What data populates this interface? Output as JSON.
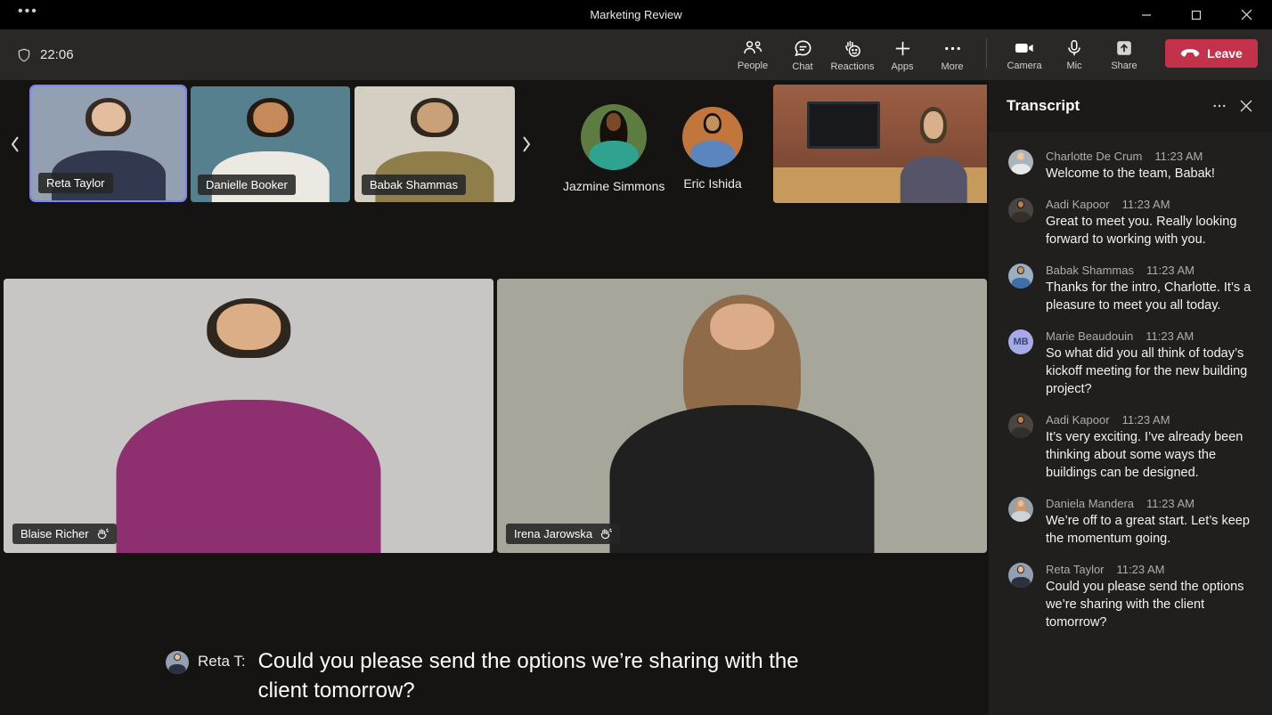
{
  "window": {
    "title": "Marketing Review",
    "controls": {
      "minimize": "minimize",
      "maximize": "maximize",
      "close": "close"
    }
  },
  "colors": {
    "titlebar_bg": "#000000",
    "toolbar_bg": "#292827",
    "main_bg": "#151413",
    "panel_bg": "#1b1a19",
    "panel_body_bg": "#201f1e",
    "leave_bg": "#c4314b",
    "speaking_border": "#7f85f5",
    "nameplate_bg": "rgba(38,38,38,0.88)",
    "text_primary": "#ffffff",
    "text_secondary": "#adadad"
  },
  "toolbar": {
    "timer": "22:06",
    "buttons": [
      {
        "label": "People"
      },
      {
        "label": "Chat"
      },
      {
        "label": "Reactions"
      },
      {
        "label": "Apps"
      },
      {
        "label": "More"
      }
    ],
    "device_buttons": [
      {
        "label": "Camera"
      },
      {
        "label": "Mic"
      },
      {
        "label": "Share"
      }
    ],
    "leave_label": "Leave"
  },
  "strip": {
    "tiles": [
      {
        "name": "Reta Taylor",
        "speaking": true,
        "palette": {
          "bg": "#93a0b2",
          "hair": "#362a22",
          "skin": "#e3bd9d",
          "shirt": "#323850"
        }
      },
      {
        "name": "Danielle Booker",
        "speaking": false,
        "palette": {
          "bg": "#57808f",
          "hair": "#241a12",
          "skin": "#c8895a",
          "shirt": "#ece8e2"
        }
      },
      {
        "name": "Babak Shammas",
        "speaking": false,
        "palette": {
          "bg": "#d5cec2",
          "hair": "#302820",
          "skin": "#c9a077",
          "shirt": "#8f7d4a"
        }
      }
    ],
    "avatars": [
      {
        "name": "Jazmine Simmons",
        "palette": {
          "bg": "#5d7c42",
          "hair": "#15100b",
          "skin": "#7a4a28",
          "shirt": "#2fa390"
        }
      },
      {
        "name": "Eric Ishida",
        "palette": {
          "bg": "#c2763c",
          "hair": "#17120e",
          "skin": "#c1925f",
          "shirt": "#5a85bd"
        }
      }
    ],
    "room_tile": {
      "palette": {
        "bg": "#9c5f45",
        "tv": "#17191c",
        "table": "#c59a5c",
        "hair": "#4a3a28",
        "skin": "#d9b08c",
        "shirt": "#555468"
      }
    }
  },
  "stage": {
    "tiles": [
      {
        "name": "Blaise Richer",
        "hand_raised": true,
        "palette": {
          "bg": "#c7c6c4",
          "hair": "#2f261e",
          "skin": "#dcae87",
          "shirt": "#8e3070"
        }
      },
      {
        "name": "Irena Jarowska",
        "hand_raised": true,
        "palette": {
          "bg": "#a6a69a",
          "hair": "#8f6b49",
          "skin": "#dcab8a",
          "shirt": "#202020"
        }
      }
    ]
  },
  "caption": {
    "speaker": "Reta T:",
    "text": "Could you please send the options we’re sharing with the client tomorrow?",
    "palette": {
      "bg": "#93a0b2",
      "hair": "#362a22",
      "skin": "#e3bd9d",
      "shirt": "#2c3142"
    }
  },
  "transcript": {
    "title": "Transcript",
    "entries": [
      {
        "name": "Charlotte De Crum",
        "time": "11:23 AM",
        "text": "Welcome to the team, Babak!",
        "avatar_type": "photo",
        "palette": {
          "bg": "#aab4bd",
          "hair": "#d9c08a",
          "skin": "#ebc7a6",
          "shirt": "#e8e8e8"
        }
      },
      {
        "name": "Aadi Kapoor",
        "time": "11:23 AM",
        "text": "Great to meet you. Really looking forward to working with you.",
        "avatar_type": "photo",
        "palette": {
          "bg": "#4a4540",
          "hair": "#201812",
          "skin": "#b97f4e",
          "shirt": "#33302c"
        }
      },
      {
        "name": "Babak Shammas",
        "time": "11:23 AM",
        "text": "Thanks for the intro, Charlotte. It’s a pleasure to meet you all today.",
        "avatar_type": "photo",
        "palette": {
          "bg": "#9ab0c0",
          "hair": "#2a221c",
          "skin": "#c49a6c",
          "shirt": "#3f6fa8"
        }
      },
      {
        "name": "Marie Beaudouin",
        "time": "11:23 AM",
        "text": "So what did you all think of today’s kickoff meeting for the new building project?",
        "avatar_type": "initials",
        "initials": "MB",
        "palette": {
          "bg": "#a6abe8",
          "fg": "#3d4077"
        }
      },
      {
        "name": "Aadi Kapoor",
        "time": "11:23 AM",
        "text": "It’s very exciting. I’ve already been thinking about some ways the buildings can be designed.",
        "avatar_type": "photo",
        "palette": {
          "bg": "#4a4540",
          "hair": "#201812",
          "skin": "#b97f4e",
          "shirt": "#33302c"
        }
      },
      {
        "name": "Daniela Mandera",
        "time": "11:23 AM",
        "text": "We’re off to a great start. Let’s keep the momentum going.",
        "avatar_type": "photo",
        "palette": {
          "bg": "#98a0a8",
          "hair": "#d29a66",
          "skin": "#e6bd9c",
          "shirt": "#cfd2d6"
        }
      },
      {
        "name": "Reta Taylor",
        "time": "11:23 AM",
        "text": "Could you please send the options we’re sharing with the client tomorrow?",
        "avatar_type": "photo",
        "palette": {
          "bg": "#93a0b2",
          "hair": "#362a22",
          "skin": "#e3bd9d",
          "shirt": "#2c3142"
        }
      }
    ]
  }
}
